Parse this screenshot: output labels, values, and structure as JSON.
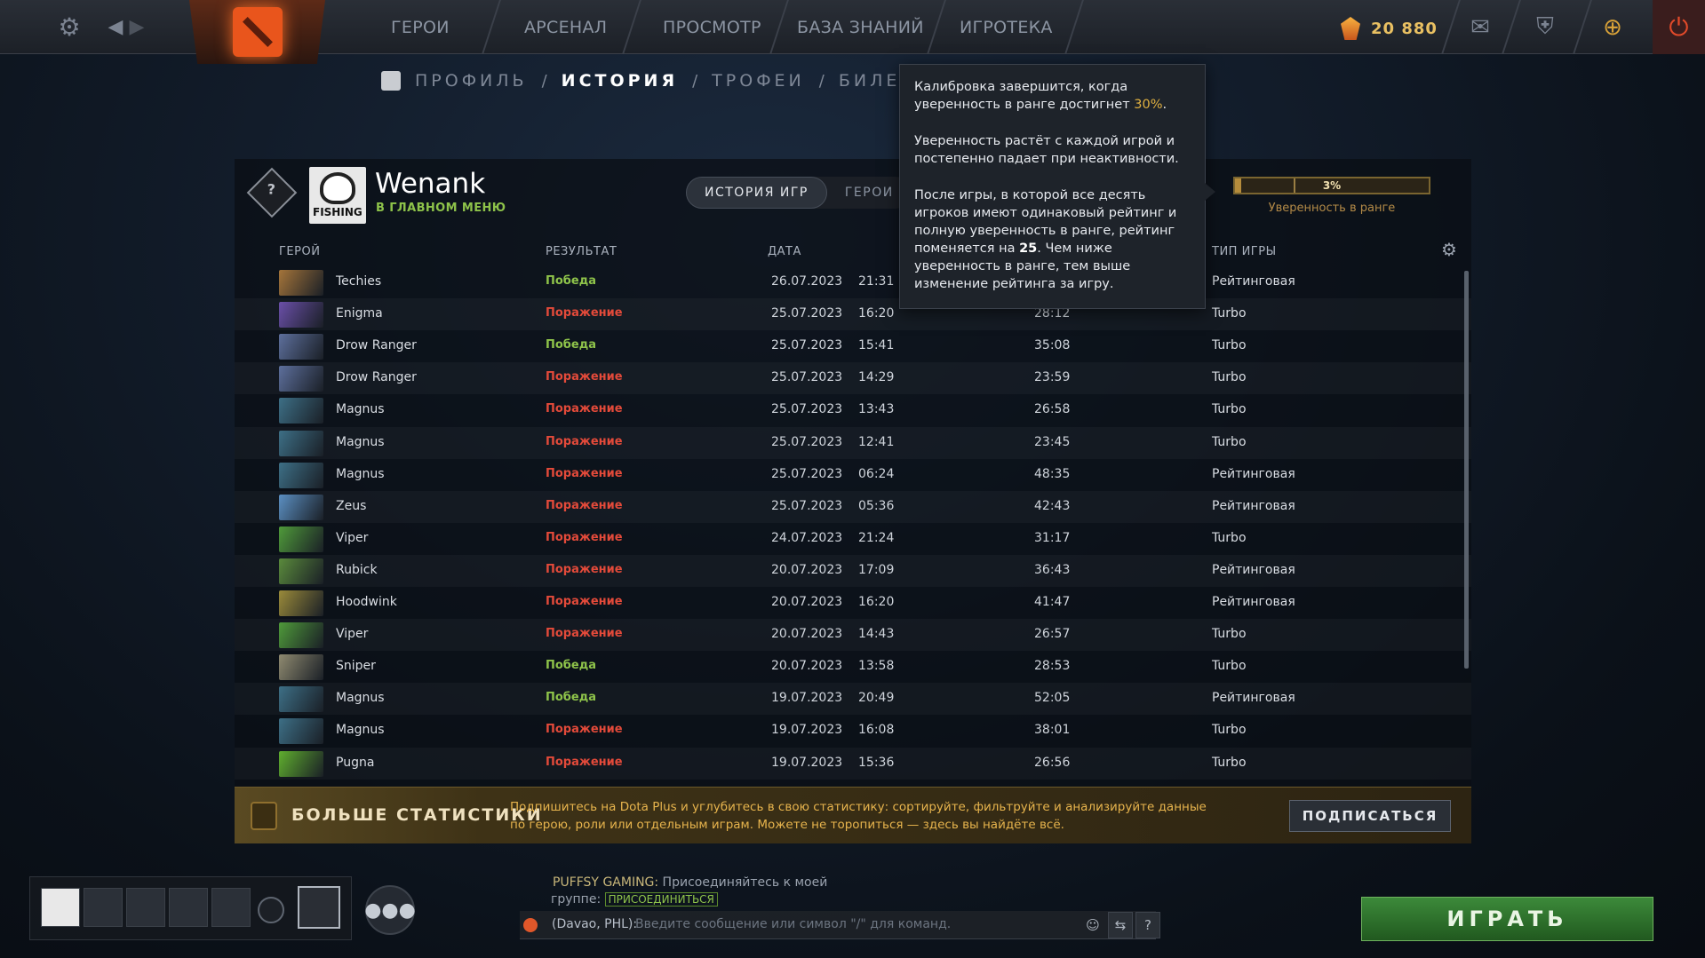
{
  "topbar": {
    "nav": [
      "ГЕРОИ",
      "АРСЕНАЛ",
      "ПРОСМОТР",
      "БАЗА ЗНАНИЙ",
      "ИГРОТЕКА"
    ],
    "shards": "20 880"
  },
  "subnav": {
    "items": [
      "ПРОФИЛЬ",
      "ИСТОРИЯ",
      "ТРОФЕИ",
      "БИЛЕТЫ"
    ],
    "active": "ИСТОРИЯ"
  },
  "profile": {
    "name": "Wenank",
    "status": "В ГЛАВНОМ МЕНЮ",
    "avatar_text": "FISHING",
    "rank_badge": "?"
  },
  "tabs": [
    "ИСТОРИЯ ИГР",
    "ГЕРОИ"
  ],
  "confidence": {
    "percent_label": "3%",
    "value": 0.03,
    "label": "Уверенность в ранге"
  },
  "tooltip": {
    "p1_a": "Калибровка завершится, когда уверенность в ранге достигнет ",
    "p1_hl": "30%",
    "p1_b": ".",
    "p2": "Уверенность растёт с каждой игрой и постепенно падает при неактивности.",
    "p3_a": "После игры, в которой все десять игроков имеют одинаковый рейтинг и полную уверенность в ранге, рейтинг поменяется на ",
    "p3_b": "25",
    "p3_c": ". Чем ниже уверенность в ранге, тем выше изменение рейтинга за игру."
  },
  "table": {
    "headers": {
      "hero": "ГЕРОЙ",
      "result": "РЕЗУЛЬТАТ",
      "date": "ДАТА",
      "type": "ТИП ИГРЫ"
    },
    "rows": [
      {
        "hero": "Techies",
        "result": "Победа",
        "win": true,
        "date": "26.07.2023",
        "time": "21:31",
        "duration": "",
        "type": "Рейтинговая",
        "color": "#a4743a"
      },
      {
        "hero": "Enigma",
        "result": "Поражение",
        "win": false,
        "date": "25.07.2023",
        "time": "16:20",
        "duration": "28:12",
        "type": "Turbo",
        "color": "#6a4fa8"
      },
      {
        "hero": "Drow Ranger",
        "result": "Победа",
        "win": true,
        "date": "25.07.2023",
        "time": "15:41",
        "duration": "35:08",
        "type": "Turbo",
        "color": "#5d6f9c"
      },
      {
        "hero": "Drow Ranger",
        "result": "Поражение",
        "win": false,
        "date": "25.07.2023",
        "time": "14:29",
        "duration": "23:59",
        "type": "Turbo",
        "color": "#5d6f9c"
      },
      {
        "hero": "Magnus",
        "result": "Поражение",
        "win": false,
        "date": "25.07.2023",
        "time": "13:43",
        "duration": "26:58",
        "type": "Turbo",
        "color": "#3d6f86"
      },
      {
        "hero": "Magnus",
        "result": "Поражение",
        "win": false,
        "date": "25.07.2023",
        "time": "12:41",
        "duration": "23:45",
        "type": "Turbo",
        "color": "#3d6f86"
      },
      {
        "hero": "Magnus",
        "result": "Поражение",
        "win": false,
        "date": "25.07.2023",
        "time": "06:24",
        "duration": "48:35",
        "type": "Рейтинговая",
        "color": "#3d6f86"
      },
      {
        "hero": "Zeus",
        "result": "Поражение",
        "win": false,
        "date": "25.07.2023",
        "time": "05:36",
        "duration": "42:43",
        "type": "Рейтинговая",
        "color": "#5b8fc2"
      },
      {
        "hero": "Viper",
        "result": "Поражение",
        "win": false,
        "date": "24.07.2023",
        "time": "21:24",
        "duration": "31:17",
        "type": "Turbo",
        "color": "#4f9a3a"
      },
      {
        "hero": "Rubick",
        "result": "Поражение",
        "win": false,
        "date": "20.07.2023",
        "time": "17:09",
        "duration": "36:43",
        "type": "Рейтинговая",
        "color": "#5a8a3c"
      },
      {
        "hero": "Hoodwink",
        "result": "Поражение",
        "win": false,
        "date": "20.07.2023",
        "time": "16:20",
        "duration": "41:47",
        "type": "Рейтинговая",
        "color": "#9a8a3a"
      },
      {
        "hero": "Viper",
        "result": "Поражение",
        "win": false,
        "date": "20.07.2023",
        "time": "14:43",
        "duration": "26:57",
        "type": "Turbo",
        "color": "#4f9a3a"
      },
      {
        "hero": "Sniper",
        "result": "Победа",
        "win": true,
        "date": "20.07.2023",
        "time": "13:58",
        "duration": "28:53",
        "type": "Turbo",
        "color": "#8f8a70"
      },
      {
        "hero": "Magnus",
        "result": "Победа",
        "win": true,
        "date": "19.07.2023",
        "time": "20:49",
        "duration": "52:05",
        "type": "Рейтинговая",
        "color": "#3d6f86"
      },
      {
        "hero": "Magnus",
        "result": "Поражение",
        "win": false,
        "date": "19.07.2023",
        "time": "16:08",
        "duration": "38:01",
        "type": "Turbo",
        "color": "#3d6f86"
      },
      {
        "hero": "Pugna",
        "result": "Поражение",
        "win": false,
        "date": "19.07.2023",
        "time": "15:36",
        "duration": "26:56",
        "type": "Turbo",
        "color": "#5fae2e"
      }
    ]
  },
  "plus": {
    "title": "БОЛЬШЕ СТАТИСТИКИ",
    "desc": "Подпишитесь на Dota Plus и углубитесь в свою статистику: сортируйте, фильтруйте и анализируйте данные по герою, роли или отдельным играм. Можете не торопиться — здесь вы найдёте всё.",
    "button": "ПОДПИСАТЬСЯ"
  },
  "chat": {
    "line1_name": "PUFFSY GAMING:",
    "line1_text": " Присоединяйтесь к моей",
    "line2_text": "группе: ",
    "line2_link": "ПРИСОЕДИНИТЬСЯ",
    "input_label": "(Davao, PHL):",
    "input_placeholder": "Введите сообщение или символ \"/\" для команд."
  },
  "play_button": "ИГРАТЬ"
}
